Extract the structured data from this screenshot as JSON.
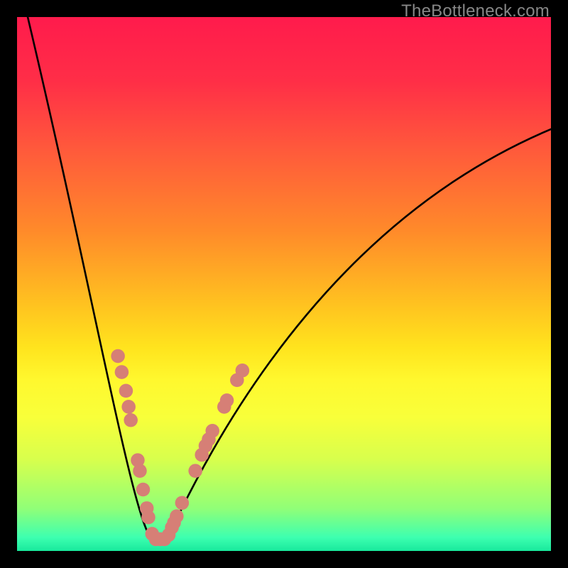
{
  "watermark": "TheBottleneck.com",
  "chart_data": {
    "type": "line",
    "title": "",
    "xlabel": "",
    "ylabel": "",
    "xlim": [
      0,
      100
    ],
    "ylim": [
      0,
      100
    ],
    "gradient_stops": [
      {
        "offset": 0.0,
        "color": "#ff1b4c"
      },
      {
        "offset": 0.12,
        "color": "#ff2e47"
      },
      {
        "offset": 0.25,
        "color": "#ff5a3b"
      },
      {
        "offset": 0.4,
        "color": "#ff8a2a"
      },
      {
        "offset": 0.55,
        "color": "#ffc71f"
      },
      {
        "offset": 0.62,
        "color": "#ffe41e"
      },
      {
        "offset": 0.68,
        "color": "#fff82e"
      },
      {
        "offset": 0.75,
        "color": "#f8ff3a"
      },
      {
        "offset": 0.83,
        "color": "#d7ff4d"
      },
      {
        "offset": 0.92,
        "color": "#91ff77"
      },
      {
        "offset": 0.975,
        "color": "#3dffb0"
      },
      {
        "offset": 1.0,
        "color": "#18e99c"
      }
    ],
    "series": [
      {
        "name": "left_curve",
        "type": "line",
        "cubic_bezier": {
          "x0": 2,
          "y0": 100,
          "cx1": 15,
          "cy1": 45,
          "cx2": 22,
          "cy2": 4,
          "x1": 25.5,
          "y1": 2
        }
      },
      {
        "name": "right_curve",
        "type": "line",
        "cubic_bezier": {
          "x0": 28,
          "y0": 2,
          "cx1": 40,
          "cy1": 28,
          "cx2": 62,
          "cy2": 63,
          "x1": 100,
          "y1": 79
        }
      },
      {
        "name": "valley_floor",
        "type": "line",
        "segment": {
          "x0": 25.5,
          "y0": 2.2,
          "x1": 28,
          "y1": 2.2
        }
      }
    ],
    "marker_points": {
      "name": "data_points",
      "color": "#d67f76",
      "radius": 1.3,
      "points": [
        {
          "x": 18.9,
          "y": 36.5
        },
        {
          "x": 19.6,
          "y": 33.5
        },
        {
          "x": 20.4,
          "y": 30.0
        },
        {
          "x": 20.9,
          "y": 27.0
        },
        {
          "x": 21.3,
          "y": 24.5
        },
        {
          "x": 22.6,
          "y": 17.0
        },
        {
          "x": 23.0,
          "y": 15.0
        },
        {
          "x": 23.6,
          "y": 11.5
        },
        {
          "x": 24.3,
          "y": 8.0
        },
        {
          "x": 24.6,
          "y": 6.3
        },
        {
          "x": 25.3,
          "y": 3.2
        },
        {
          "x": 26.0,
          "y": 2.2
        },
        {
          "x": 26.8,
          "y": 2.2
        },
        {
          "x": 27.6,
          "y": 2.2
        },
        {
          "x": 28.4,
          "y": 3.0
        },
        {
          "x": 29.0,
          "y": 4.4
        },
        {
          "x": 29.4,
          "y": 5.3
        },
        {
          "x": 29.9,
          "y": 6.5
        },
        {
          "x": 30.9,
          "y": 9.0
        },
        {
          "x": 33.4,
          "y": 15.0
        },
        {
          "x": 34.6,
          "y": 18.0
        },
        {
          "x": 35.3,
          "y": 19.7
        },
        {
          "x": 35.9,
          "y": 20.9
        },
        {
          "x": 36.6,
          "y": 22.5
        },
        {
          "x": 38.8,
          "y": 27.0
        },
        {
          "x": 39.3,
          "y": 28.2
        },
        {
          "x": 41.2,
          "y": 32.0
        },
        {
          "x": 42.2,
          "y": 33.8
        }
      ]
    }
  }
}
